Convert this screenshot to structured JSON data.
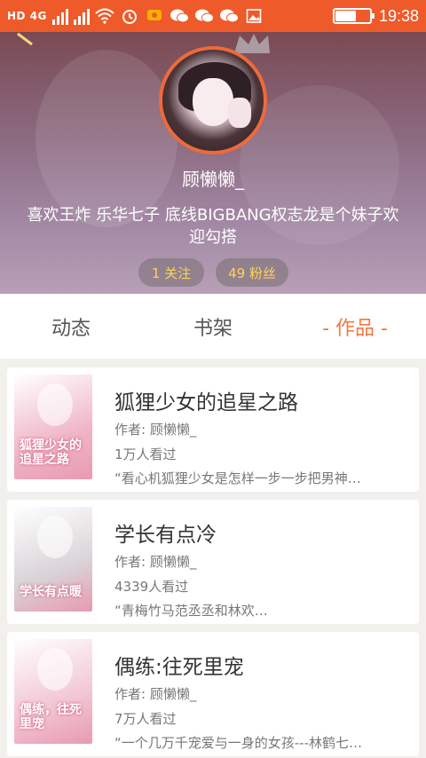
{
  "status_bar": {
    "network": "HD 4G",
    "time": "19:38",
    "battery_level": 0.6,
    "icons": [
      "signal-icon",
      "signal-x-icon",
      "wifi-icon",
      "alarm-icon",
      "notification-icon",
      "wechat-icon",
      "wechat-icon",
      "wechat-icon",
      "image-icon"
    ]
  },
  "colors": {
    "accent": "#ee5a2a",
    "tab_active": "#ee7a46",
    "count": "#ffd35a"
  },
  "profile": {
    "username": "顾懒懒_",
    "bio": "喜欢王炸 乐华七子 底线BIGBANG权志龙是个妹子欢迎勾搭",
    "following_label": "1 关注",
    "fans_label": "49 粉丝"
  },
  "tabs": [
    {
      "label": "动态",
      "active": false
    },
    {
      "label": "书架",
      "active": false
    },
    {
      "label": "- 作品 -",
      "active": true
    }
  ],
  "works": [
    {
      "title": "狐狸少女的追星之路",
      "author": "作者: 顾懒懒_",
      "views": "1万人看过",
      "desc": "“看心机狐狸少女是怎样一步一步把男神…",
      "cover_text": "狐狸少女的追星之路",
      "cover_color": "#f0b6c8"
    },
    {
      "title": "学长有点冷",
      "author": "作者: 顾懒懒_",
      "views": "4339人看过",
      "desc": "“青梅竹马范丞丞和林欢…",
      "cover_text": "学长有点暖",
      "cover_color": "#d9d3d8"
    },
    {
      "title": "偶练:往死里宠",
      "author": "作者: 顾懒懒_",
      "views": "7万人看过",
      "desc": "“一个几万千宠爱与一身的女孩---林鹤七…",
      "cover_text": "偶练，往死里宠",
      "cover_color": "#f2c6d4"
    }
  ]
}
